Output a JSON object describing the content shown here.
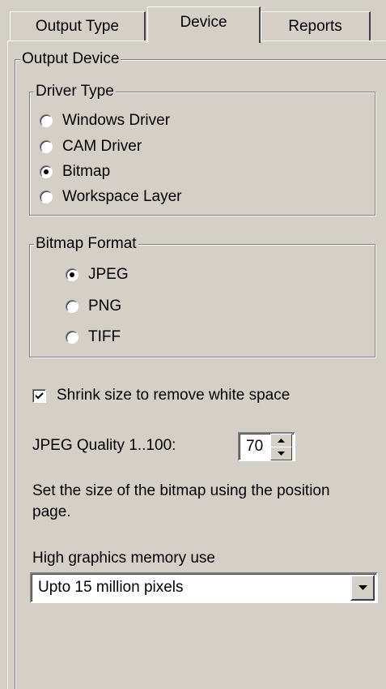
{
  "tabs": [
    {
      "label": "Output Type"
    },
    {
      "label": "Device"
    },
    {
      "label": "Reports"
    }
  ],
  "output_device": {
    "legend": "Output Device",
    "driver_type": {
      "legend": "Driver Type",
      "options": [
        "Windows Driver",
        "CAM Driver",
        "Bitmap",
        "Workspace Layer"
      ],
      "selected": "Bitmap"
    },
    "bitmap_format": {
      "legend": "Bitmap Format",
      "options": [
        "JPEG",
        "PNG",
        "TIFF"
      ],
      "selected": "JPEG"
    },
    "shrink": {
      "label": "Shrink size to remove white space",
      "checked": true
    },
    "quality": {
      "label": "JPEG Quality 1..100:",
      "value": "70"
    },
    "info_text": {
      "line1": "Set the size of the bitmap using the position",
      "line2": "page."
    },
    "memory": {
      "label": "High graphics memory use",
      "selected": "Upto 15 million pixels"
    }
  }
}
